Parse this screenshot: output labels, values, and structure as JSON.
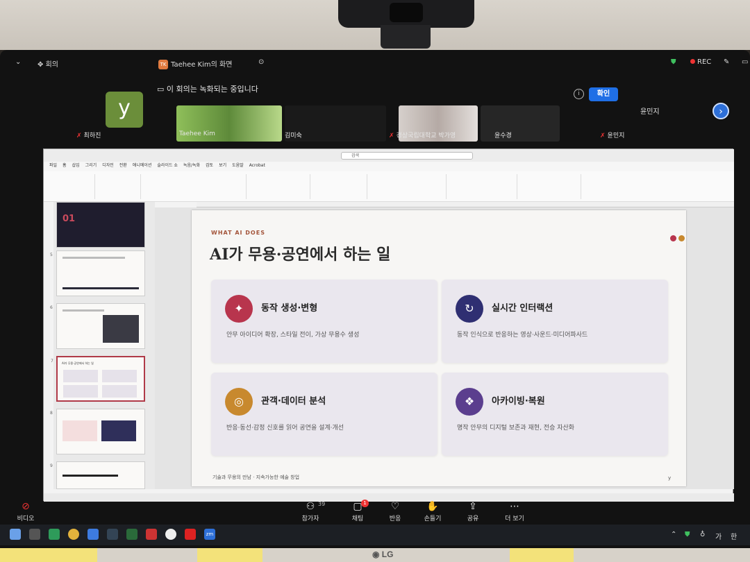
{
  "zoom": {
    "top_bar": {
      "meeting_label": "회의",
      "share_badge": "TK",
      "share_label": "Taehee Kim의 화면",
      "rec_label": "REC"
    },
    "notice": {
      "text": "이 회의는 녹화되는 중입니다",
      "confirm": "확인"
    },
    "participants": [
      {
        "name": "최하진",
        "avatar": "y"
      },
      {
        "name": "Taehee Kim"
      },
      {
        "name": "김미숙"
      },
      {
        "name": "경상국립대학교 박가영"
      },
      {
        "name": "윤수경"
      },
      {
        "name": "윤민지"
      }
    ],
    "speaker_name": "윤민지",
    "bottom_bar": {
      "video": "비디오",
      "participants": "참가자",
      "participants_count": "39",
      "chat": "채팅",
      "chat_badge": "1",
      "reactions": "반응",
      "raise_hand": "손들기",
      "share": "공유",
      "more": "더 보기"
    }
  },
  "powerpoint": {
    "search_placeholder": "검색",
    "menu": [
      "파일",
      "홈",
      "삽입",
      "그리기",
      "디자인",
      "전환",
      "애니메이션",
      "슬라이드 쇼",
      "녹음/녹화",
      "검토",
      "보기",
      "도움말",
      "Acrobat"
    ],
    "slide": {
      "kicker": "WHAT AI DOES",
      "title": "AI가 무용·공연에서 하는 일",
      "cards": [
        {
          "icon": "✦",
          "title": "동작 생성·변형",
          "desc": "안무 아이디어 확장, 스타일 전이, 가상 무용수 생성",
          "color": "#b8354d"
        },
        {
          "icon": "↻",
          "title": "실시간 인터랙션",
          "desc": "동작 인식으로 반응하는 영상·사운드·미디어파사드",
          "color": "#2f2f72"
        },
        {
          "icon": "◎",
          "title": "관객·데이터 분석",
          "desc": "반응·동선·감정 신호를 읽어 공연을 설계·개선",
          "color": "#c8892e"
        },
        {
          "icon": "❖",
          "title": "아카이빙·복원",
          "desc": "명작 안무의 디지털 보존과 재현, 전승 자산화",
          "color": "#5b3e8e"
        }
      ],
      "footer": "기술과 무용의 만남 · 지속가능한 예술 창업",
      "page_mark": "y"
    },
    "thumbs": [
      {
        "num": "",
        "title": "01"
      },
      {
        "num": "5",
        "title": ""
      },
      {
        "num": "6",
        "title": ""
      },
      {
        "num": "7",
        "title": "AI가 무용·공연에서 하는 일"
      },
      {
        "num": "8",
        "title": ""
      },
      {
        "num": "9",
        "title": ""
      }
    ]
  },
  "taskbar": {
    "tray_lang": "가",
    "tray_ime": "한"
  }
}
